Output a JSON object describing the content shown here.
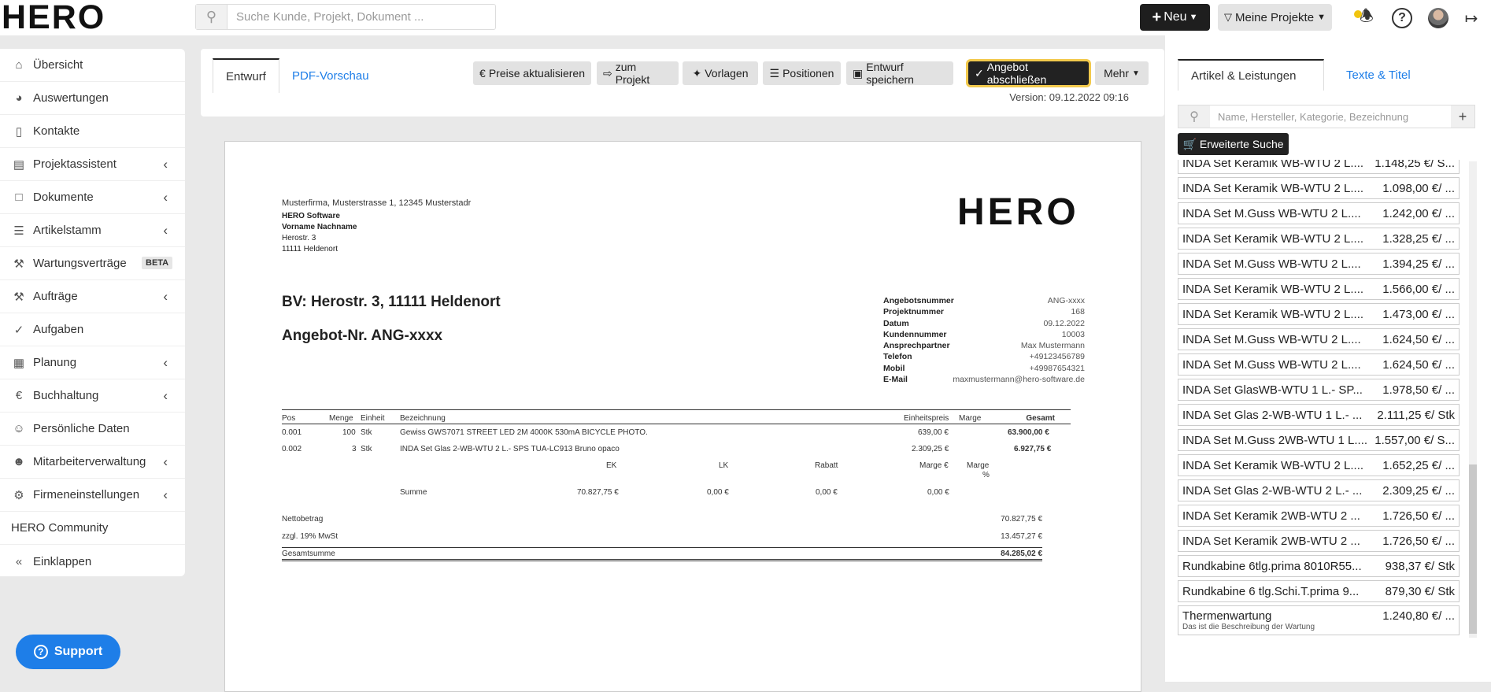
{
  "brand": {
    "logo_text": "HERO"
  },
  "header": {
    "search_placeholder": "Suche Kunde, Projekt, Dokument ...",
    "new_label": "Neu",
    "projects_label": "Meine Projekte"
  },
  "sidebar": {
    "items": [
      {
        "label": "Übersicht",
        "icon": "home-icon"
      },
      {
        "label": "Auswertungen",
        "icon": "pie-chart-icon"
      },
      {
        "label": "Kontakte",
        "icon": "address-book-icon"
      },
      {
        "label": "Projektassistent",
        "icon": "inbox-icon"
      },
      {
        "label": "Dokumente",
        "icon": "document-icon"
      },
      {
        "label": "Artikelstamm",
        "icon": "list-icon"
      },
      {
        "label": "Wartungsverträge",
        "icon": "wrench-icon",
        "badge": "BETA"
      },
      {
        "label": "Aufträge",
        "icon": "wrench-icon"
      },
      {
        "label": "Aufgaben",
        "icon": "check-circle-icon"
      },
      {
        "label": "Planung",
        "icon": "calendar-icon"
      },
      {
        "label": "Buchhaltung",
        "icon": "euro-icon"
      },
      {
        "label": "Persönliche Daten",
        "icon": "user-icon"
      },
      {
        "label": "Mitarbeiterverwaltung",
        "icon": "users-icon"
      },
      {
        "label": "Firmeneinstellungen",
        "icon": "gear-icon"
      },
      {
        "label": "HERO Community",
        "icon": ""
      },
      {
        "label": "Einklappen",
        "icon": "double-chevron-left-icon"
      }
    ],
    "support_label": "Support"
  },
  "editor": {
    "tab_draft": "Entwurf",
    "tab_preview": "PDF-Vorschau",
    "btn_prices": "Preise aktualisieren",
    "btn_project": "zum Projekt",
    "btn_templates": "Vorlagen",
    "btn_positions": "Positionen",
    "btn_save": "Entwurf speichern",
    "btn_finish": "Angebot abschließen",
    "btn_more": "Mehr",
    "version": "Version: 09.12.2022 09:16"
  },
  "document": {
    "sender_line": "Musterfirma, Musterstrasse 1, 12345 Musterstadr",
    "recipient": [
      "HERO Software",
      "Vorname Nachname",
      "Herostr. 3",
      "11111 Heldenort"
    ],
    "logo_text": "HERO",
    "bv": "BV: Herostr. 3, 11111 Heldenort",
    "offer_title": "Angebot-Nr. ANG-xxxx",
    "meta": [
      {
        "label": "Angebotsnummer",
        "value": "ANG-xxxx"
      },
      {
        "label": "Projektnummer",
        "value": "168"
      },
      {
        "label": "Datum",
        "value": "09.12.2022"
      },
      {
        "label": "Kundennummer",
        "value": "10003"
      },
      {
        "label": "Ansprechpartner",
        "value": "Max Mustermann"
      },
      {
        "label": "Telefon",
        "value": "+49123456789"
      },
      {
        "label": "Mobil",
        "value": "+49987654321"
      },
      {
        "label": "E-Mail",
        "value": "maxmustermann@hero-software.de"
      }
    ],
    "table_headers": {
      "pos": "Pos",
      "menge": "Menge",
      "einheit": "Einheit",
      "bez": "Bezeichnung",
      "ep": "Einheitspreis",
      "marge": "Marge",
      "gesamt": "Gesamt"
    },
    "rows": [
      {
        "pos": "0.001",
        "menge": "100",
        "einheit": "Stk",
        "bez": "Gewiss GWS7071 STREET LED 2M 4000K 530mA BICYCLE PHOTO.",
        "ep": "639,00 €",
        "gesamt": "63.900,00 €"
      },
      {
        "pos": "0.002",
        "menge": "3",
        "einheit": "Stk",
        "bez": "INDA Set Glas 2-WB-WTU 2 L.- SPS TUA-LC913 Bruno opaco",
        "ep": "2.309,25 €",
        "gesamt": "6.927,75 €"
      }
    ],
    "calc_headers": {
      "ek": "EK",
      "lk": "LK",
      "rabatt": "Rabatt",
      "marge_eur": "Marge €",
      "marge_pct_1": "Marge",
      "marge_pct_2": "%"
    },
    "summe": {
      "label": "Summe",
      "ek": "70.827,75 €",
      "lk": "0,00 €",
      "rabatt": "0,00 €",
      "marge": "0,00 €"
    },
    "totals": [
      {
        "label": "Nettobetrag",
        "value": "70.827,75 €"
      },
      {
        "label": "zzgl. 19% MwSt",
        "value": "13.457,27 €"
      },
      {
        "label": "Gesamtsumme",
        "value": "84.285,02 €"
      }
    ]
  },
  "articles": {
    "tab_active": "Artikel & Leistungen",
    "tab_other": "Texte & Titel",
    "search_placeholder": "Name, Hersteller, Kategorie, Bezeichnung",
    "advanced_search": "Erweiterte Suche",
    "items": [
      {
        "name": "INDA Set Keramik WB-WTU 2 L....",
        "price": "1.148,25 €/ S..."
      },
      {
        "name": "INDA Set Keramik WB-WTU 2 L....",
        "price": "1.098,00 €/ ..."
      },
      {
        "name": "INDA Set M.Guss WB-WTU 2 L....",
        "price": "1.242,00 €/ ..."
      },
      {
        "name": "INDA Set Keramik WB-WTU 2 L....",
        "price": "1.328,25 €/ ..."
      },
      {
        "name": "INDA Set M.Guss WB-WTU 2 L....",
        "price": "1.394,25 €/ ..."
      },
      {
        "name": "INDA Set Keramik WB-WTU 2 L....",
        "price": "1.566,00 €/ ..."
      },
      {
        "name": "INDA Set Keramik WB-WTU 2 L....",
        "price": "1.473,00 €/ ..."
      },
      {
        "name": "INDA Set M.Guss WB-WTU 2 L....",
        "price": "1.624,50 €/ ..."
      },
      {
        "name": "INDA Set M.Guss WB-WTU 2 L....",
        "price": "1.624,50 €/ ..."
      },
      {
        "name": "INDA Set GlasWB-WTU 1 L.- SP...",
        "price": "1.978,50 €/ ..."
      },
      {
        "name": "INDA Set Glas 2-WB-WTU 1 L.- ...",
        "price": "2.111,25 €/ Stk"
      },
      {
        "name": "INDA Set M.Guss 2WB-WTU 1 L....",
        "price": "1.557,00 €/ S..."
      },
      {
        "name": "INDA Set Keramik WB-WTU 2 L....",
        "price": "1.652,25 €/ ..."
      },
      {
        "name": "INDA Set Glas 2-WB-WTU 2 L.- ...",
        "price": "2.309,25 €/ ..."
      },
      {
        "name": "INDA Set Keramik 2WB-WTU 2 ...",
        "price": "1.726,50 €/ ..."
      },
      {
        "name": "INDA Set Keramik 2WB-WTU 2 ...",
        "price": "1.726,50 €/ ..."
      },
      {
        "name": "Rundkabine 6tlg.prima 8010R55...",
        "price": "938,37 €/ Stk"
      },
      {
        "name": "Rundkabine 6 tlg.Schi.T.prima 9...",
        "price": "879,30 €/ Stk"
      }
    ],
    "last_item": {
      "name": "Thermenwartung",
      "price": "1.240,80 €/ ...",
      "desc": "Das ist die Beschreibung der Wartung"
    }
  }
}
